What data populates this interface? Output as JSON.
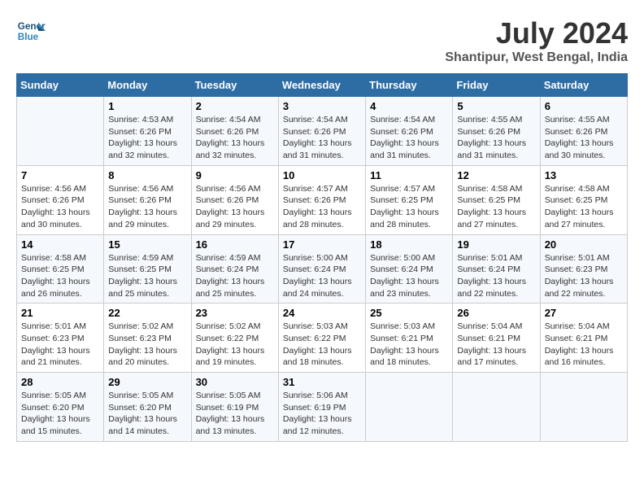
{
  "logo": {
    "line1": "General",
    "line2": "Blue"
  },
  "title": "July 2024",
  "location": "Shantipur, West Bengal, India",
  "days_of_week": [
    "Sunday",
    "Monday",
    "Tuesday",
    "Wednesday",
    "Thursday",
    "Friday",
    "Saturday"
  ],
  "weeks": [
    [
      {
        "day": "",
        "sunrise": "",
        "sunset": "",
        "daylight": ""
      },
      {
        "day": "1",
        "sunrise": "Sunrise: 4:53 AM",
        "sunset": "Sunset: 6:26 PM",
        "daylight": "Daylight: 13 hours and 32 minutes."
      },
      {
        "day": "2",
        "sunrise": "Sunrise: 4:54 AM",
        "sunset": "Sunset: 6:26 PM",
        "daylight": "Daylight: 13 hours and 32 minutes."
      },
      {
        "day": "3",
        "sunrise": "Sunrise: 4:54 AM",
        "sunset": "Sunset: 6:26 PM",
        "daylight": "Daylight: 13 hours and 31 minutes."
      },
      {
        "day": "4",
        "sunrise": "Sunrise: 4:54 AM",
        "sunset": "Sunset: 6:26 PM",
        "daylight": "Daylight: 13 hours and 31 minutes."
      },
      {
        "day": "5",
        "sunrise": "Sunrise: 4:55 AM",
        "sunset": "Sunset: 6:26 PM",
        "daylight": "Daylight: 13 hours and 31 minutes."
      },
      {
        "day": "6",
        "sunrise": "Sunrise: 4:55 AM",
        "sunset": "Sunset: 6:26 PM",
        "daylight": "Daylight: 13 hours and 30 minutes."
      }
    ],
    [
      {
        "day": "7",
        "sunrise": "Sunrise: 4:56 AM",
        "sunset": "Sunset: 6:26 PM",
        "daylight": "Daylight: 13 hours and 30 minutes."
      },
      {
        "day": "8",
        "sunrise": "Sunrise: 4:56 AM",
        "sunset": "Sunset: 6:26 PM",
        "daylight": "Daylight: 13 hours and 29 minutes."
      },
      {
        "day": "9",
        "sunrise": "Sunrise: 4:56 AM",
        "sunset": "Sunset: 6:26 PM",
        "daylight": "Daylight: 13 hours and 29 minutes."
      },
      {
        "day": "10",
        "sunrise": "Sunrise: 4:57 AM",
        "sunset": "Sunset: 6:26 PM",
        "daylight": "Daylight: 13 hours and 28 minutes."
      },
      {
        "day": "11",
        "sunrise": "Sunrise: 4:57 AM",
        "sunset": "Sunset: 6:25 PM",
        "daylight": "Daylight: 13 hours and 28 minutes."
      },
      {
        "day": "12",
        "sunrise": "Sunrise: 4:58 AM",
        "sunset": "Sunset: 6:25 PM",
        "daylight": "Daylight: 13 hours and 27 minutes."
      },
      {
        "day": "13",
        "sunrise": "Sunrise: 4:58 AM",
        "sunset": "Sunset: 6:25 PM",
        "daylight": "Daylight: 13 hours and 27 minutes."
      }
    ],
    [
      {
        "day": "14",
        "sunrise": "Sunrise: 4:58 AM",
        "sunset": "Sunset: 6:25 PM",
        "daylight": "Daylight: 13 hours and 26 minutes."
      },
      {
        "day": "15",
        "sunrise": "Sunrise: 4:59 AM",
        "sunset": "Sunset: 6:25 PM",
        "daylight": "Daylight: 13 hours and 25 minutes."
      },
      {
        "day": "16",
        "sunrise": "Sunrise: 4:59 AM",
        "sunset": "Sunset: 6:24 PM",
        "daylight": "Daylight: 13 hours and 25 minutes."
      },
      {
        "day": "17",
        "sunrise": "Sunrise: 5:00 AM",
        "sunset": "Sunset: 6:24 PM",
        "daylight": "Daylight: 13 hours and 24 minutes."
      },
      {
        "day": "18",
        "sunrise": "Sunrise: 5:00 AM",
        "sunset": "Sunset: 6:24 PM",
        "daylight": "Daylight: 13 hours and 23 minutes."
      },
      {
        "day": "19",
        "sunrise": "Sunrise: 5:01 AM",
        "sunset": "Sunset: 6:24 PM",
        "daylight": "Daylight: 13 hours and 22 minutes."
      },
      {
        "day": "20",
        "sunrise": "Sunrise: 5:01 AM",
        "sunset": "Sunset: 6:23 PM",
        "daylight": "Daylight: 13 hours and 22 minutes."
      }
    ],
    [
      {
        "day": "21",
        "sunrise": "Sunrise: 5:01 AM",
        "sunset": "Sunset: 6:23 PM",
        "daylight": "Daylight: 13 hours and 21 minutes."
      },
      {
        "day": "22",
        "sunrise": "Sunrise: 5:02 AM",
        "sunset": "Sunset: 6:23 PM",
        "daylight": "Daylight: 13 hours and 20 minutes."
      },
      {
        "day": "23",
        "sunrise": "Sunrise: 5:02 AM",
        "sunset": "Sunset: 6:22 PM",
        "daylight": "Daylight: 13 hours and 19 minutes."
      },
      {
        "day": "24",
        "sunrise": "Sunrise: 5:03 AM",
        "sunset": "Sunset: 6:22 PM",
        "daylight": "Daylight: 13 hours and 18 minutes."
      },
      {
        "day": "25",
        "sunrise": "Sunrise: 5:03 AM",
        "sunset": "Sunset: 6:21 PM",
        "daylight": "Daylight: 13 hours and 18 minutes."
      },
      {
        "day": "26",
        "sunrise": "Sunrise: 5:04 AM",
        "sunset": "Sunset: 6:21 PM",
        "daylight": "Daylight: 13 hours and 17 minutes."
      },
      {
        "day": "27",
        "sunrise": "Sunrise: 5:04 AM",
        "sunset": "Sunset: 6:21 PM",
        "daylight": "Daylight: 13 hours and 16 minutes."
      }
    ],
    [
      {
        "day": "28",
        "sunrise": "Sunrise: 5:05 AM",
        "sunset": "Sunset: 6:20 PM",
        "daylight": "Daylight: 13 hours and 15 minutes."
      },
      {
        "day": "29",
        "sunrise": "Sunrise: 5:05 AM",
        "sunset": "Sunset: 6:20 PM",
        "daylight": "Daylight: 13 hours and 14 minutes."
      },
      {
        "day": "30",
        "sunrise": "Sunrise: 5:05 AM",
        "sunset": "Sunset: 6:19 PM",
        "daylight": "Daylight: 13 hours and 13 minutes."
      },
      {
        "day": "31",
        "sunrise": "Sunrise: 5:06 AM",
        "sunset": "Sunset: 6:19 PM",
        "daylight": "Daylight: 13 hours and 12 minutes."
      },
      {
        "day": "",
        "sunrise": "",
        "sunset": "",
        "daylight": ""
      },
      {
        "day": "",
        "sunrise": "",
        "sunset": "",
        "daylight": ""
      },
      {
        "day": "",
        "sunrise": "",
        "sunset": "",
        "daylight": ""
      }
    ]
  ]
}
